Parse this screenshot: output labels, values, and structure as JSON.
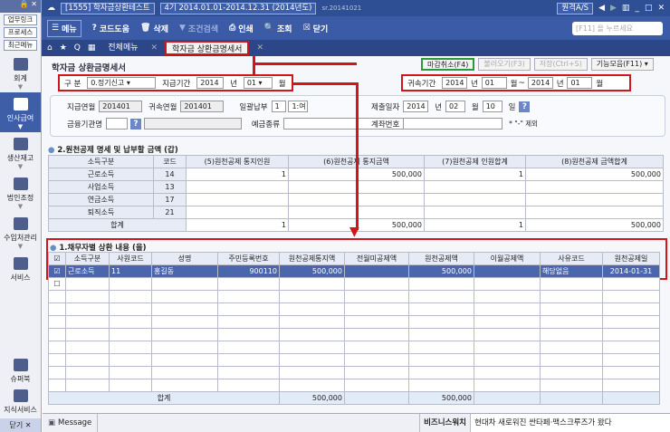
{
  "sidebar": {
    "links": [
      "업무링크",
      "프로세스",
      "최근메뉴"
    ],
    "items": [
      {
        "label": "회계"
      },
      {
        "label": "인사급여"
      },
      {
        "label": "생산재고"
      },
      {
        "label": "법인조정"
      },
      {
        "label": "수입처관리"
      },
      {
        "label": "서비스"
      },
      {
        "label": "슈퍼북"
      },
      {
        "label": "지식서비스"
      }
    ],
    "close": "닫기 ✕"
  },
  "titlebar": {
    "company": "[1555] 학자금상환테스트",
    "period": "4기 2014.01.01-2014.12.31 (2014년도)",
    "version": "sr.20141021",
    "support": "원격A/S"
  },
  "toolbar": {
    "menu": "메뉴",
    "code_help": "코드도움",
    "delete": "삭제",
    "filter": "조건검색",
    "print": "인쇄",
    "inquiry": "조회",
    "close": "닫기",
    "search_placeholder": "[F11] 을 누르세요"
  },
  "tabs": {
    "all_menu": "전체메뉴",
    "active": "학자금 상환금명세서"
  },
  "page": {
    "title": "학자금 상환금명세서",
    "buttons": {
      "cancel_close": "마감취소(F4)",
      "load": "불러오기(F3)",
      "save": "저장(Ctrl+S)",
      "functions": "기능모음(F11)"
    }
  },
  "filters": {
    "gubun_label": "구 분",
    "gubun_value": "0.정기신고",
    "pay_period_label": "지급기간",
    "pay_year": "2014",
    "year": "년",
    "pay_month": "01",
    "month": "월",
    "belong_label": "귀속기간",
    "belong_from_year": "2014",
    "belong_from_month": "01",
    "tilde": "~",
    "belong_to_year": "2014",
    "belong_to_month": "01"
  },
  "info": {
    "pay_ym_label": "지급연월",
    "pay_ym": "201401",
    "belong_ym_label": "귀속연월",
    "belong_ym": "201401",
    "bulk_label": "일괄납부",
    "bulk_value": "1",
    "bulk_text": "1:여",
    "submit_label": "제출일자",
    "submit_year": "2014",
    "year": "년",
    "submit_month": "02",
    "month": "월",
    "submit_day": "10",
    "day": "일",
    "bank_label": "금융기관명",
    "deposit_label": "예금종류",
    "account_label": "계좌번호",
    "account_note": "* \"-\" 제외"
  },
  "section2": {
    "title": "2.원천공제 명세 및 납부할 금액 (갑)",
    "headers": [
      "소득구분",
      "코드",
      "(5)원천공제 통지인원",
      "(6)원천공제 통지금액",
      "(7)원천공제 인원합계",
      "(8)원천공제 금액합계"
    ],
    "rows": [
      [
        "근로소득",
        "14",
        "1",
        "500,000",
        "1",
        "500,000"
      ],
      [
        "사업소득",
        "13",
        "",
        "",
        "",
        ""
      ],
      [
        "연금소득",
        "17",
        "",
        "",
        "",
        ""
      ],
      [
        "퇴직소득",
        "21",
        "",
        "",
        "",
        ""
      ]
    ],
    "total": [
      "합계",
      "1",
      "500,000",
      "1",
      "500,000"
    ]
  },
  "section1": {
    "title": "1.채무자별 상환 내용 (을)",
    "headers": [
      "소득구분",
      "사원코드",
      "성명",
      "주민등록번호",
      "원천공제통지액",
      "전월미공제액",
      "원천공제액",
      "이월공제액",
      "사유코드",
      "원천공제일"
    ],
    "rows": [
      [
        "근로소득",
        "11",
        "홍길동",
        "900110",
        "500,000",
        "",
        "500,000",
        "",
        "해당없음",
        "2014-01-31"
      ]
    ],
    "total_label": "합계",
    "total_notice": "500,000",
    "total_deducted": "500,000"
  },
  "status": {
    "message": "Message",
    "biz_watch": "비즈니스워치",
    "news": "현대차 새로워진 싼타페·맥스크루즈가 왔다"
  }
}
